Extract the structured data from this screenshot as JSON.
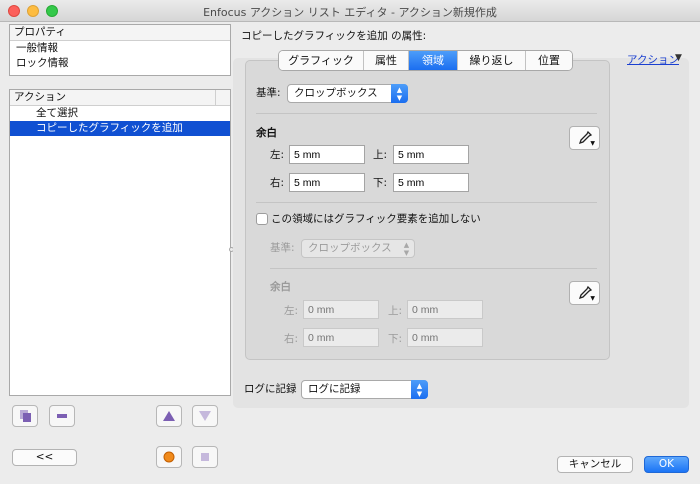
{
  "window": {
    "title": "Enfocus アクション リスト エディタ - アクション新規作成"
  },
  "properties_panel": {
    "header": "プロパティ",
    "items": [
      "一般情報",
      "ロック情報"
    ]
  },
  "actions_panel": {
    "header": "アクション",
    "items": [
      {
        "label": "全て選択",
        "selected": false
      },
      {
        "label": "コピーしたグラフィックを追加",
        "selected": true
      }
    ]
  },
  "bottom_left": {
    "collapse_label": "<<"
  },
  "editor": {
    "title": "コピーしたグラフィックを追加 の属性:",
    "action_link": "アクション",
    "action_link_arrow": "▼",
    "tabs": [
      {
        "label": "グラフィック",
        "active": false
      },
      {
        "label": "属性",
        "active": false
      },
      {
        "label": "領域",
        "active": true
      },
      {
        "label": "繰り返し",
        "active": false
      },
      {
        "label": "位置",
        "active": false
      }
    ],
    "basis": {
      "label": "基準:",
      "value": "クロップボックス"
    },
    "margin": {
      "title": "余白",
      "left_label": "左:",
      "left_value": "5 mm",
      "top_label": "上:",
      "top_value": "5 mm",
      "right_label": "右:",
      "right_value": "5 mm",
      "bottom_label": "下:",
      "bottom_value": "5 mm"
    },
    "no_graphic_area": {
      "label": "この領域にはグラフィック要素を追加しない",
      "checked": false
    },
    "basis2": {
      "label": "基準:",
      "value": "クロップボックス"
    },
    "margin2": {
      "title": "余白",
      "left_label": "左:",
      "left_placeholder": "0 mm",
      "top_label": "上:",
      "top_placeholder": "0 mm",
      "right_label": "右:",
      "right_placeholder": "0 mm",
      "bottom_label": "下:",
      "bottom_placeholder": "0 mm"
    },
    "log": {
      "label": "ログに記録",
      "value": "ログに記録"
    }
  },
  "footer": {
    "cancel_label": "キャンセル",
    "ok_label": "OK"
  },
  "colors": {
    "accent": "#1b6ef0",
    "selection": "#1050d2",
    "link": "#1a3fd0"
  }
}
